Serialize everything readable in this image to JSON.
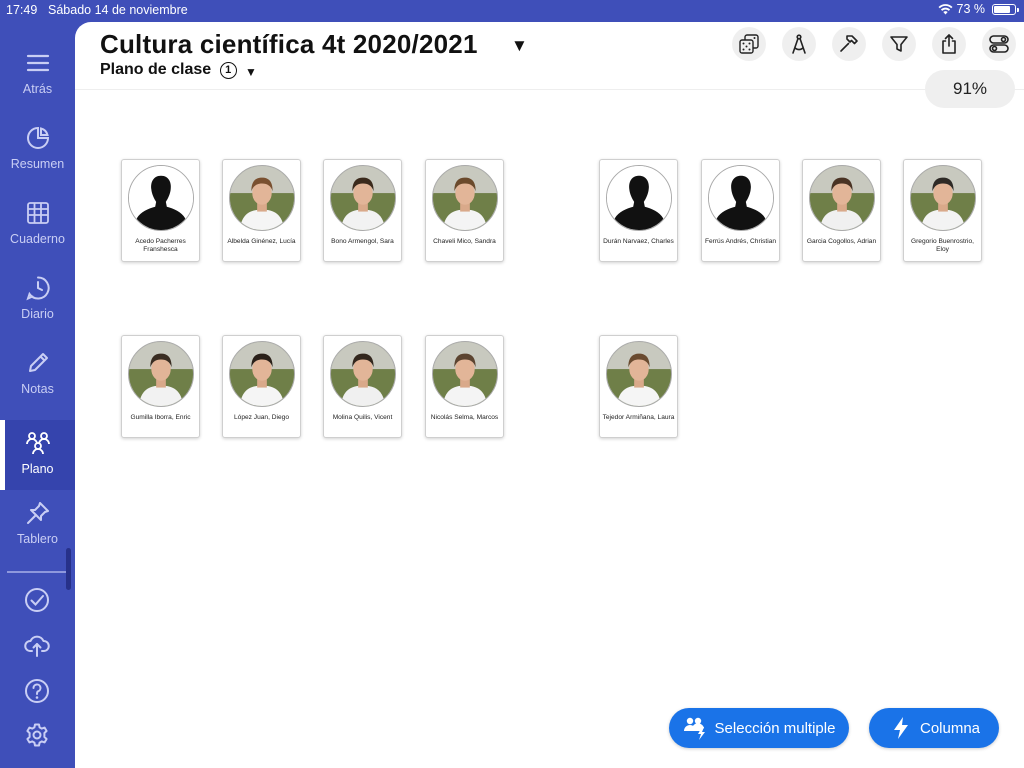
{
  "status_bar": {
    "time": "17:49",
    "date": "Sábado 14 de noviembre",
    "battery": "73 %",
    "battery_level": 0.73
  },
  "sidebar": {
    "items": [
      {
        "label": "Atrás",
        "icon": "menu-icon"
      },
      {
        "label": "Resumen",
        "icon": "pie-chart-icon"
      },
      {
        "label": "Cuaderno",
        "icon": "grid-icon"
      },
      {
        "label": "Diario",
        "icon": "clock-chat-icon"
      },
      {
        "label": "Notas",
        "icon": "pencil-icon"
      },
      {
        "label": "Plano",
        "icon": "people-icon",
        "active": true
      },
      {
        "label": "Tablero",
        "icon": "pin-icon"
      }
    ],
    "utilities": [
      "checkmark-circle-icon",
      "cloud-upload-icon",
      "help-icon",
      "settings-icon"
    ]
  },
  "header": {
    "title": "Cultura científica 4t 2020/2021",
    "subtitle": "Plano de clase",
    "subtitle_badge": "1",
    "zoom": "91%",
    "tools": [
      "dice-icon",
      "compass-icon",
      "hammer-icon",
      "filter-icon",
      "share-icon",
      "toggles-icon"
    ]
  },
  "students": [
    {
      "name": "Acedo Pacherres Franshesca",
      "photo": false
    },
    {
      "name": "Albelda Ginénez, Lucía",
      "photo": true,
      "hair": "#7a5030",
      "shirt": "#f5f5f5"
    },
    {
      "name": "Bono Armengol, Sara",
      "photo": true,
      "hair": "#3b2a1c",
      "shirt": "#f2f2f2"
    },
    {
      "name": "Chaveli Mico, Sandra",
      "photo": true,
      "hair": "#6b4a2c",
      "shirt": "#f4f4f4"
    },
    {
      "name": "Durán Narvaez, Charles",
      "photo": false
    },
    {
      "name": "Ferrús Andrés, Christian",
      "photo": false
    },
    {
      "name": "Garcia Cogollos, Adrian",
      "photo": true,
      "hair": "#4a3324",
      "shirt": "#f0f0f0"
    },
    {
      "name": "Gregorio Buenrostrio, Eloy",
      "photo": true,
      "hair": "#2e2a26",
      "shirt": "#f3f3f3"
    },
    {
      "name": "Gumilla Iborra, Enric",
      "photo": true,
      "hair": "#3a2d22",
      "shirt": "#f2f2f2"
    },
    {
      "name": "López Juan, Diego",
      "photo": true,
      "hair": "#2b211a",
      "shirt": "#f5f5f5"
    },
    {
      "name": "Molina Quilis, Vicent",
      "photo": true,
      "hair": "#33271d",
      "shirt": "#f0f0f0"
    },
    {
      "name": "Nicolás Selma, Marcos",
      "photo": true,
      "hair": "#5c4430",
      "shirt": "#f4f4f4"
    },
    {
      "name": "Tejedor Armiñana, Laura",
      "photo": true,
      "hair": "#6a4b30",
      "shirt": "#f5f5f5"
    }
  ],
  "buttons": {
    "multi_select": "Selección multiple",
    "column": "Columna"
  },
  "colors": {
    "sidebar": "#3f4fb9",
    "accent": "#1a73e8"
  }
}
